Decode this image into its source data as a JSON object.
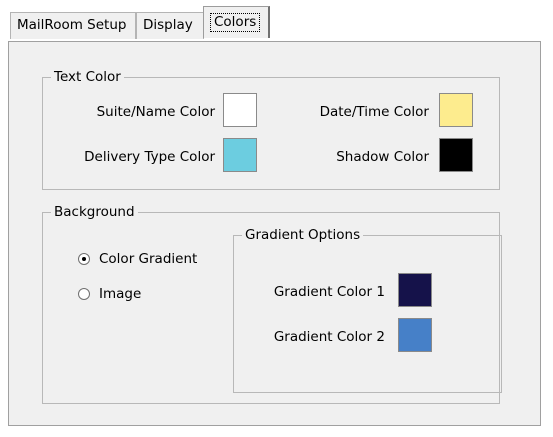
{
  "tabs": [
    {
      "label": "MailRoom Setup",
      "active": false
    },
    {
      "label": "Display",
      "active": false
    },
    {
      "label": "Colors",
      "active": true
    }
  ],
  "text_color": {
    "legend": "Text Color",
    "suite_name": {
      "label": "Suite/Name Color",
      "color": "#ffffff"
    },
    "date_time": {
      "label": "Date/Time Color",
      "color": "#fdec8e"
    },
    "delivery_type": {
      "label": "Delivery Type Color",
      "color": "#6ccde0"
    },
    "shadow": {
      "label": "Shadow Color",
      "color": "#000000"
    }
  },
  "background": {
    "legend": "Background",
    "options": [
      {
        "label": "Color Gradient",
        "checked": true
      },
      {
        "label": "Image",
        "checked": false
      }
    ]
  },
  "gradient_options": {
    "legend": "Gradient Options",
    "color1": {
      "label": "Gradient Color 1",
      "color": "#15124a"
    },
    "color2": {
      "label": "Gradient Color 2",
      "color": "#4680c8"
    }
  }
}
